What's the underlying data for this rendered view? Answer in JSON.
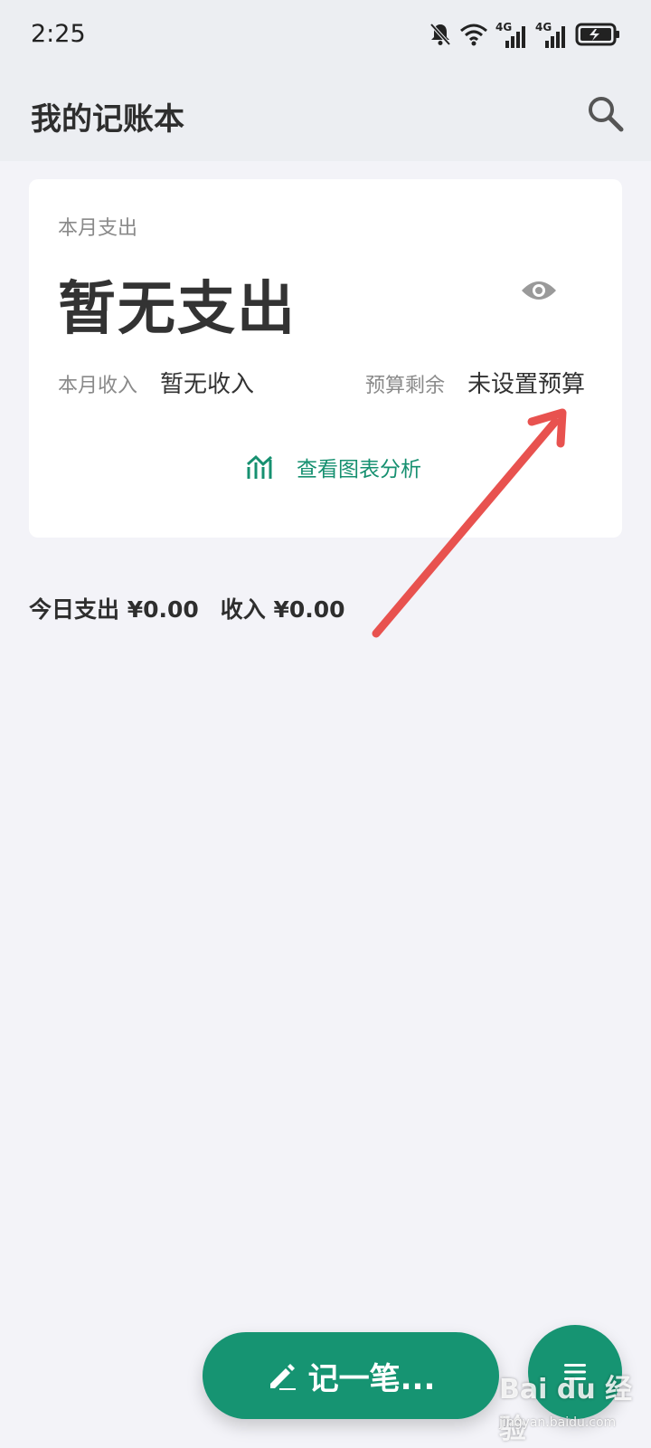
{
  "status_bar": {
    "time": "2:25",
    "icons": [
      "bell-off-icon",
      "wifi-icon",
      "signal-4g-icon",
      "signal-4g-icon",
      "battery-icon"
    ],
    "network_label_1": "4G",
    "network_label_2": "4G"
  },
  "header": {
    "title": "我的记账本",
    "search_icon": "search-icon"
  },
  "summary_card": {
    "month_expense_label": "本月支出",
    "month_expense_value": "暂无支出",
    "eye_icon": "eye-icon",
    "month_income_label": "本月收入",
    "month_income_value": "暂无收入",
    "budget_label": "预算剩余",
    "budget_value": "未设置预算",
    "chart_link_label": "查看图表分析",
    "chart_icon": "chart-icon"
  },
  "today": {
    "expense": "今日支出 ¥0.00",
    "income": "收入 ¥0.00"
  },
  "annotation": {
    "arrow_color": "#e8524f"
  },
  "fab": {
    "record_label": "记一笔...",
    "record_icon": "pencil-icon",
    "menu_icon": "menu-icon"
  },
  "watermark": {
    "text": "Bai du 经验",
    "sub": "jingyan.baidu.com"
  },
  "colors": {
    "accent": "#169472",
    "background": "#f3f3f8",
    "card": "#ffffff"
  }
}
